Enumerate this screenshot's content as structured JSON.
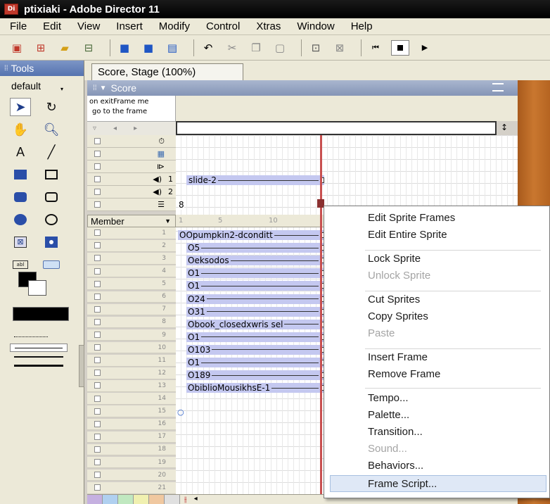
{
  "window": {
    "app_icon": "Di",
    "title": "ptixiaki - Adobe Director 11"
  },
  "menubar": [
    "File",
    "Edit",
    "View",
    "Insert",
    "Modify",
    "Control",
    "Xtras",
    "Window",
    "Help"
  ],
  "toolbar": {
    "icons": [
      "new-movie-icon",
      "new-cast-icon",
      "open-icon",
      "import-icon",
      "save-icon",
      "save-all-icon",
      "publish-icon",
      "undo-icon",
      "cut-icon",
      "copy-icon",
      "paste-icon",
      "find-icon",
      "script-icon",
      "rewind-icon",
      "stop-icon",
      "play-icon"
    ]
  },
  "tools": {
    "header": "Tools",
    "selector": "default",
    "items": [
      "arrow",
      "rotate",
      "hand",
      "zoom",
      "text",
      "line",
      "filled-rect",
      "rect",
      "filled-round-rect",
      "round-rect",
      "filled-ellipse",
      "ellipse",
      "checkbox",
      "radio",
      "field",
      "button"
    ]
  },
  "tab": {
    "label": "Score, Stage (100%)"
  },
  "score": {
    "title": "Score",
    "script_preview": [
      "on exitFrame me",
      "go to the frame"
    ],
    "special_channel_marker": "8",
    "member_label": "Member",
    "ruler": [
      "1",
      "5",
      "10"
    ],
    "channels": [
      "1",
      "2",
      "3",
      "4",
      "5",
      "6",
      "7",
      "8",
      "9",
      "10",
      "11",
      "12",
      "13",
      "14",
      "15",
      "16",
      "17",
      "18",
      "19",
      "20",
      "21"
    ],
    "special_channels": [
      {
        "icon": "tempo-icon",
        "label": ""
      },
      {
        "icon": "palette-icon",
        "label": ""
      },
      {
        "icon": "transition-icon",
        "label": ""
      },
      {
        "icon": "sound-icon",
        "label": "1"
      },
      {
        "icon": "sound-icon",
        "label": "2"
      },
      {
        "icon": "script-channel-icon",
        "label": ""
      }
    ],
    "sound_sprite": "slide-2",
    "sprites": [
      "Opumpkin2-dconditt",
      "5",
      "eksodos",
      "1",
      "1",
      "24",
      "31",
      "book_closedxwris sel",
      "1",
      "103",
      "1",
      "189",
      "biblioMousikhsE-1"
    ]
  },
  "context_menu": {
    "items": [
      {
        "label": "Edit Sprite Frames",
        "enabled": true
      },
      {
        "label": "Edit Entire Sprite",
        "enabled": true
      },
      {
        "label": "Lock Sprite",
        "enabled": true
      },
      {
        "label": "Unlock Sprite",
        "enabled": false
      },
      {
        "label": "Cut Sprites",
        "enabled": true
      },
      {
        "label": "Copy Sprites",
        "enabled": true
      },
      {
        "label": "Paste",
        "enabled": false
      },
      {
        "label": "Insert Frame",
        "enabled": true
      },
      {
        "label": "Remove Frame",
        "enabled": true
      },
      {
        "label": "Tempo...",
        "enabled": true
      },
      {
        "label": "Palette...",
        "enabled": true
      },
      {
        "label": "Transition...",
        "enabled": true
      },
      {
        "label": "Sound...",
        "enabled": false
      },
      {
        "label": "Behaviors...",
        "enabled": true
      },
      {
        "label": "Frame Script...",
        "enabled": true,
        "hovered": true
      }
    ]
  }
}
